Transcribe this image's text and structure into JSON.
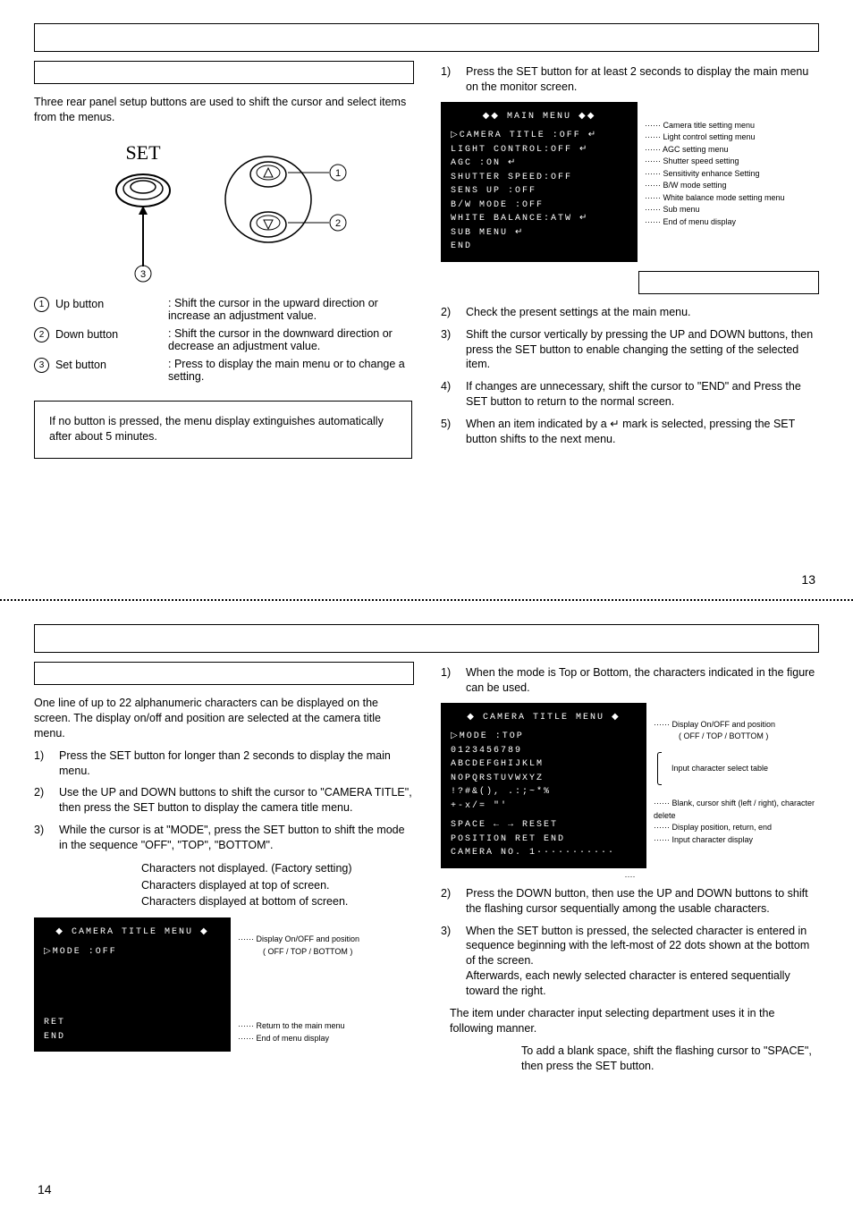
{
  "page13": {
    "intro": "Three rear panel setup buttons are used to shift the cursor and select items from the menus.",
    "set_label": "SET",
    "btn1": {
      "label": "Up button",
      "desc": ": Shift the cursor in the upward direction or increase an adjustment value."
    },
    "btn2": {
      "label": "Down button",
      "desc": ": Shift the cursor in the downward direction or decrease an adjustment value."
    },
    "btn3": {
      "label": "Set button",
      "desc": ": Press to display the main menu or to change a setting."
    },
    "note": "If no button is pressed, the menu display extinguishes automatically after about 5 minutes.",
    "steps": {
      "s1": "Press the SET button for at least 2 seconds to display the main menu on the monitor screen.",
      "s2": "Check the present settings at the main menu.",
      "s3": "Shift the cursor vertically by pressing the UP and DOWN buttons, then press the SET button to enable changing the setting of the selected item.",
      "s4": "If changes are unnecessary, shift the cursor to \"END\" and Press the SET button to return to the normal screen.",
      "s5": "When an item indicated by a  ↵  mark is selected, pressing the SET button shifts to the next menu."
    },
    "osd": {
      "title": "◆◆  MAIN  MENU  ◆◆",
      "lines": [
        "▷CAMERA  TITLE  :OFF ↵",
        "  LIGHT  CONTROL:OFF ↵",
        "  AGC           :ON  ↵",
        "  SHUTTER  SPEED:OFF",
        "  SENS  UP      :OFF",
        "  B/W  MODE     :OFF",
        "  WHITE  BALANCE:ATW ↵",
        "  SUB  MENU ↵",
        "  END"
      ]
    },
    "osd_caps": [
      "Camera title setting menu",
      "Light control setting menu",
      "AGC setting menu",
      "Shutter speed setting",
      "Sensitivity enhance Setting",
      "B/W mode setting",
      "White balance mode setting menu",
      "Sub menu",
      "End of menu display"
    ],
    "page_number": "13"
  },
  "page14": {
    "intro": "One line of up to 22 alphanumeric characters can be displayed on the screen. The display on/off and position are selected at the camera title menu.",
    "steps_a": {
      "s1": "Press the SET button for longer than 2 seconds to display the main menu.",
      "s2": "Use the UP and DOWN buttons to shift the cursor to \"CAMERA TITLE\", then press the SET button to display the camera title menu.",
      "s3": "While the cursor is at \"MODE\", press the SET button to shift the mode in the sequence \"OFF\", \"TOP\", \"BOTTOM\"."
    },
    "modes": {
      "off": "Characters not displayed. (Factory setting)",
      "top": "Characters displayed at top of screen.",
      "bottom": "Characters displayed at bottom of screen."
    },
    "osd_off": {
      "title": "◆  CAMERA  TITLE  MENU  ◆",
      "line1": "▷MODE      :OFF",
      "ret": "RET",
      "end": "END"
    },
    "osd_off_caps": {
      "c1": "Display On/OFF and position",
      "c1b": "( OFF / TOP / BOTTOM )",
      "c2": "Return to the main menu",
      "c3": "End of menu display"
    },
    "right_intro": "When the mode is Top or Bottom, the characters indicated in the figure can be used.",
    "osd_top": {
      "title": "◆  CAMERA  TITLE  MENU  ◆",
      "l1": "▷MODE         :TOP",
      "l2": "   0123456789",
      "l3": "   ABCDEFGHIJKLM",
      "l4": "   NOPQRSTUVWXYZ",
      "l5": "   !?#&(), .:;~*%",
      "l6": "   +-x/= \"'",
      "l7": "SPACE   ←   →   RESET",
      "l8": "POSITION RET    END",
      "l9": "CAMERA  NO. 1···········"
    },
    "osd_top_caps": {
      "c1": "Display On/OFF and position",
      "c1b": "( OFF / TOP / BOTTOM )",
      "c2": "Input character select table",
      "c3": "Blank, cursor shift (left / right), character delete",
      "c4": "Display position, return, end",
      "c5": "Input character display"
    },
    "steps_b": {
      "s2": "Press the DOWN button, then use the UP and DOWN buttons to shift the flashing cursor sequentially among the usable characters.",
      "s3": "When the SET button is pressed, the selected character is entered in sequence beginning with the left-most of 22 dots shown at the bottom of the screen.",
      "s3b": "Afterwards, each newly selected character is entered sequentially toward the right."
    },
    "tail1": "The item under character input selecting department uses it in the following manner.",
    "tail2": "To add a blank space, shift the flashing cursor to \"SPACE\", then press the SET button.",
    "page_number": "14"
  }
}
